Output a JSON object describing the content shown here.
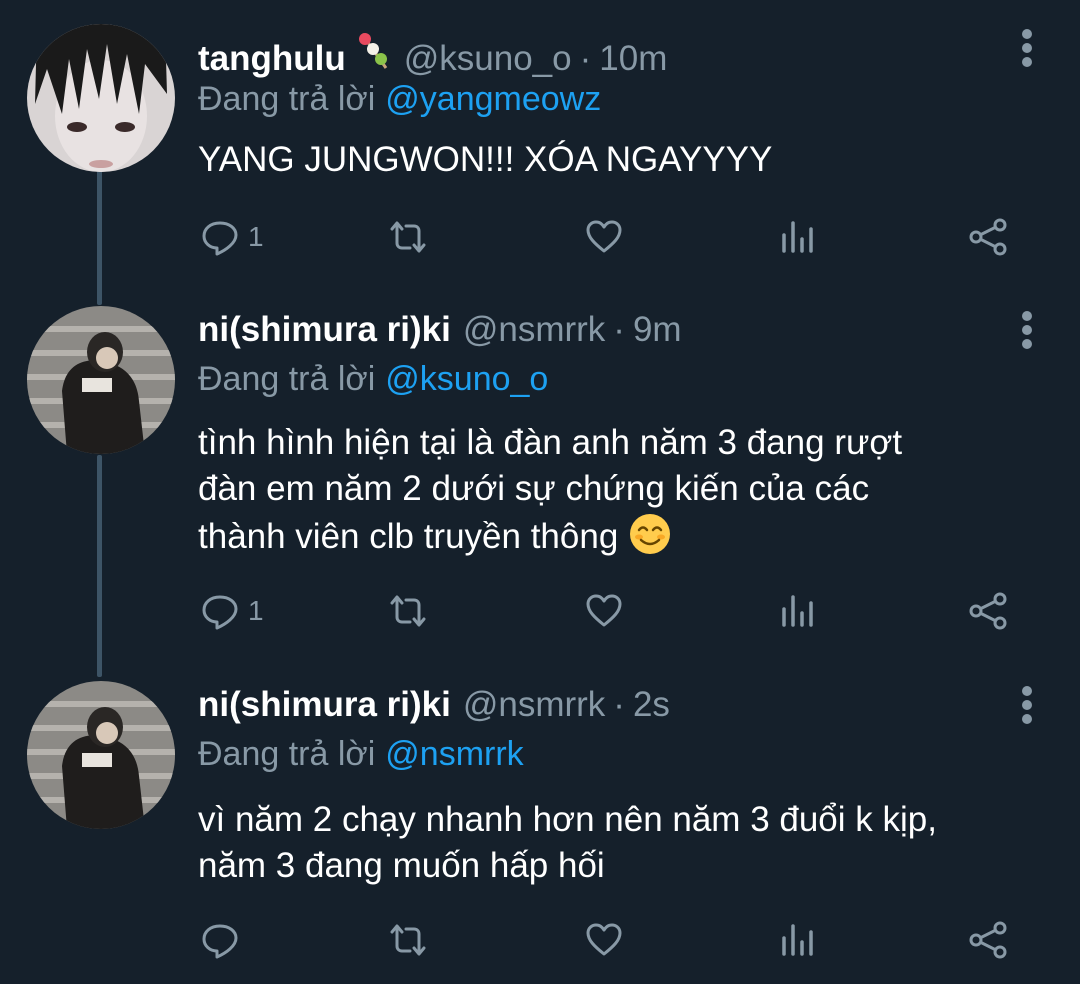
{
  "tweets": [
    {
      "name": "tanghulu",
      "handle": "@ksuno_o",
      "time": "10m",
      "reply_prefix": "Đang trả lời",
      "reply_to": "@yangmeowz",
      "lines": [
        "YANG JUNGWON!!! XÓA NGAYYYY"
      ],
      "reply_count": "1",
      "name_emoji": "tanghulu-candy-icon"
    },
    {
      "name": "ni(shimura ri)ki",
      "handle": "@nsmrrk",
      "time": "9m",
      "reply_prefix": "Đang trả lời",
      "reply_to": "@ksuno_o",
      "lines": [
        "tình hình hiện tại là đàn anh năm 3 đang rượt",
        "đàn em năm 2 dưới sự chứng kiến của các",
        "thành viên clb truyền thông"
      ],
      "reply_count": "1",
      "body_emoji": "smiling-face-icon"
    },
    {
      "name": "ni(shimura ri)ki",
      "handle": "@nsmrrk",
      "time": "2s",
      "reply_prefix": "Đang trả lời",
      "reply_to": "@nsmrrk",
      "lines": [
        "vì năm 2 chạy nhanh hơn nên năm 3 đuổi k kịp,",
        "năm 3 đang muốn hấp hối"
      ],
      "reply_count": ""
    }
  ],
  "colors": {
    "background": "#15202b",
    "secondary_text": "#8899a6",
    "link": "#1da1f2",
    "thread_line": "#3d5466"
  }
}
